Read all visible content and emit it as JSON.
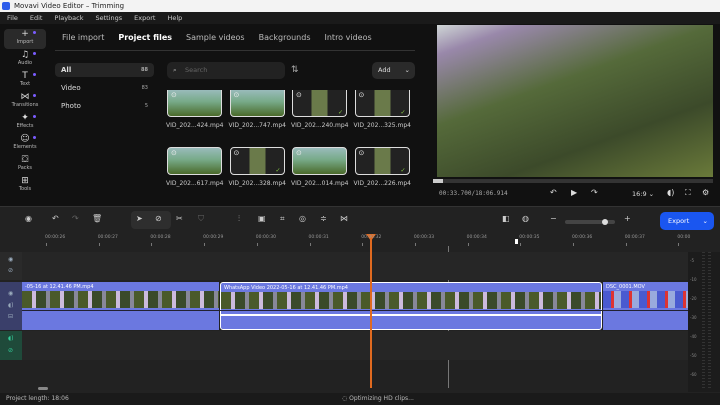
{
  "window": {
    "title": "Movavi Video Editor – Trimming"
  },
  "menu": [
    "File",
    "Edit",
    "Playback",
    "Settings",
    "Export",
    "Help"
  ],
  "sidebar": [
    {
      "label": "Import",
      "icon": "plus-icon",
      "glyph": "+"
    },
    {
      "label": "Audio",
      "icon": "music-icon",
      "glyph": "♫"
    },
    {
      "label": "Text",
      "icon": "text-icon",
      "glyph": "T"
    },
    {
      "label": "Transitions",
      "icon": "transitions-icon",
      "glyph": "⋈"
    },
    {
      "label": "Effects",
      "icon": "effects-icon",
      "glyph": "✦"
    },
    {
      "label": "Elements",
      "icon": "elements-icon",
      "glyph": "☺"
    },
    {
      "label": "Packs",
      "icon": "packs-icon",
      "glyph": "⛋"
    },
    {
      "label": "Tools",
      "icon": "tools-icon",
      "glyph": "⊞"
    }
  ],
  "tabs": [
    "File import",
    "Project files",
    "Sample videos",
    "Backgrounds",
    "Intro videos"
  ],
  "categories": [
    {
      "label": "All",
      "count": "88"
    },
    {
      "label": "Video",
      "count": "83"
    },
    {
      "label": "Photo",
      "count": "5"
    }
  ],
  "search": {
    "placeholder": "Search"
  },
  "add_label": "Add",
  "files": [
    {
      "name": "VID_202...424.mp4",
      "v": false
    },
    {
      "name": "VID_202...747.mp4",
      "v": false
    },
    {
      "name": "VID_202...240.mp4",
      "v": true
    },
    {
      "name": "VID_202...325.mp4",
      "v": true
    },
    {
      "name": "VID_202...617.mp4",
      "v": false
    },
    {
      "name": "VID_202...328.mp4",
      "v": true
    },
    {
      "name": "VID_202...014.mp4",
      "v": false
    },
    {
      "name": "VID_202...226.mp4",
      "v": true
    }
  ],
  "player": {
    "timecode": "00:33.700/18:06.914",
    "aspect": "16:9",
    "progress_fraction": 0.03
  },
  "timeline": {
    "export_label": "Export",
    "ticks": [
      "00:00:26",
      "00:00:27",
      "00:00:28",
      "00:00:29",
      "00:00:30",
      "00:00:31",
      "00:00:32",
      "00:00:33",
      "00:00:34",
      "00:00:35",
      "00:00:36",
      "00:00:37",
      "00:00"
    ],
    "clips": [
      "-05-16 at 12.41.46 PM.mp4",
      "WhatsApp Video 2022-05-16 at 12.41.46 PM.mp4",
      "DSC_0001.MOV"
    ],
    "meter": [
      "-5",
      "-10",
      "-20",
      "-30",
      "-40",
      "-50",
      "-60"
    ]
  },
  "status": {
    "project_length": "Project length: 18:06",
    "message": "Optimizing HD clips..."
  },
  "colors": {
    "accent": "#1a56f0",
    "playhead": "#e06a20",
    "clip": "#6b78e0"
  }
}
